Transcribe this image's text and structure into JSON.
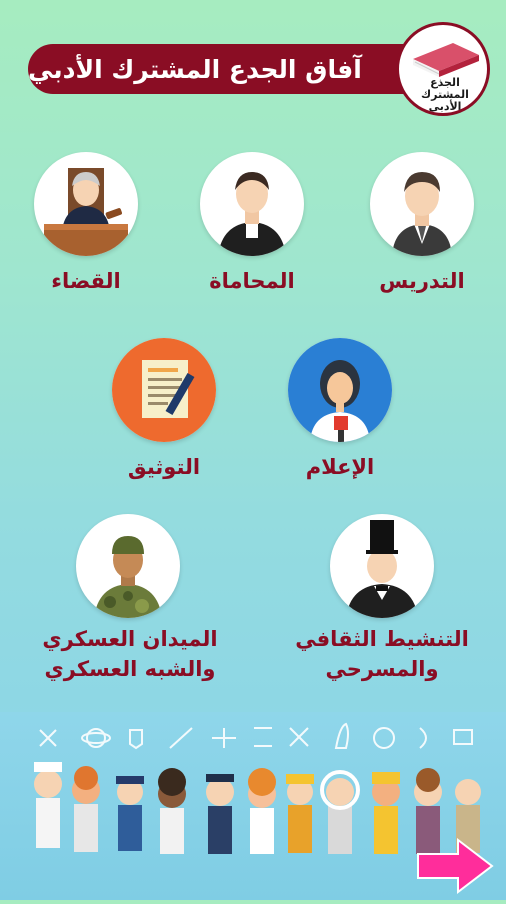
{
  "header": {
    "title": "آفاق الجدع المشترك الأدبي",
    "badge_label": "الجذع المشترك الأدبي"
  },
  "careers": [
    {
      "label": "التدريس",
      "icon": "teacher-icon"
    },
    {
      "label": "المحاماة",
      "icon": "lawyer-icon"
    },
    {
      "label": "القضاء",
      "icon": "judge-icon"
    },
    {
      "label": "الإعلام",
      "icon": "journalist-icon"
    },
    {
      "label": "التوثيق",
      "icon": "document-icon"
    },
    {
      "label": "التنشيط الثقافي والمسرحي",
      "line1": "التنشيط الثقافي",
      "line2": "والمسرحي",
      "icon": "magician-icon"
    },
    {
      "label": "الميدان العسكري والشبه العسكري",
      "line1": "الميدان العسكري",
      "line2": "والشبه العسكري",
      "icon": "soldier-icon"
    }
  ],
  "colors": {
    "accent": "#8a0d24",
    "background_top": "#a6ecc0",
    "background_bottom": "#88d2ea",
    "next_arrow": "#ff2d9b"
  },
  "footer": {
    "illustration": "professions-group-illustration",
    "next_icon": "next-arrow-icon"
  }
}
